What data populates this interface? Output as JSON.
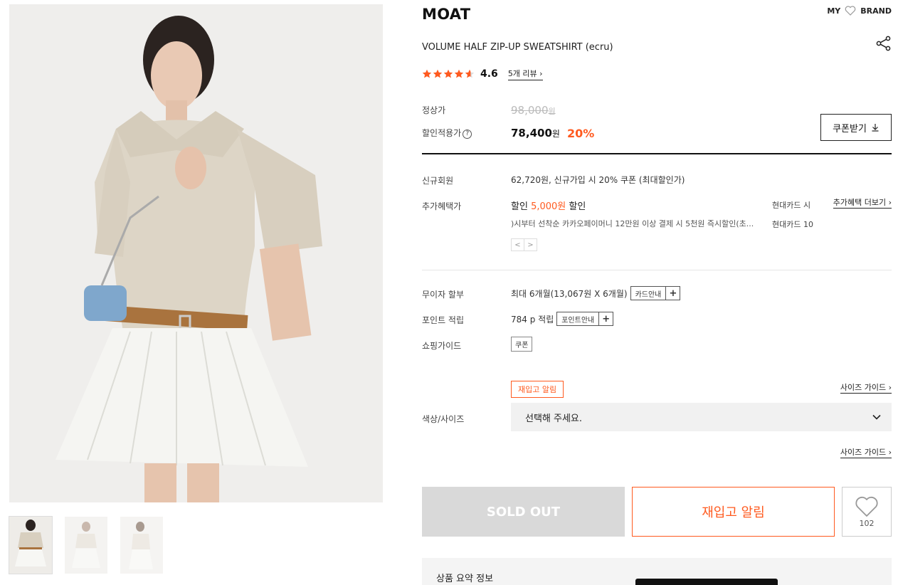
{
  "gallery": {
    "main_image_alt": "model wearing ecru half zip-up sweatshirt and white pleated skirt",
    "thumbnails": [
      "thumb-1",
      "thumb-2",
      "thumb-3"
    ]
  },
  "header": {
    "brand": "MOAT",
    "my_label": "MY",
    "brand_label": "BRAND"
  },
  "product": {
    "title": "VOLUME HALF ZIP-UP SWEATSHIRT (ecru)",
    "rating": "4.6",
    "rating_value": 4.6,
    "review_link": "5개 리뷰"
  },
  "price": {
    "regular_label": "정상가",
    "regular_value": "98,000",
    "regular_unit": "원",
    "sale_label": "할인적용가",
    "sale_value": "78,400",
    "sale_unit": "원",
    "discount": "20%",
    "coupon_button": "쿠폰받기",
    "help_symbol": "?"
  },
  "benefits": {
    "new_member_label": "신규회원",
    "new_member_value": "62,720원, 신규가입 시 20% 쿠폰 (최대할인가)",
    "extra_label": "추가혜택가",
    "extra_main_prefix": "할인 ",
    "extra_main_amount": "5,000원",
    "extra_main_suffix": " 할인",
    "extra_sub": ")시부터 선착순 카카오페이머니 12만원 이상 결제 시 5천원 즉시할인(초...",
    "card_1": "현대카드 시",
    "card_2": "현대카드 10",
    "more_link": "추가혜택 더보기",
    "pager_prev": "<",
    "pager_next": ">"
  },
  "installment": {
    "label": "무이자 할부",
    "value": "최대 6개월(13,067원 X 6개월)",
    "button": "카드안내"
  },
  "points": {
    "label": "포인트 적립",
    "value": "784 p 적립",
    "button": "포인트안내"
  },
  "shopping_guide": {
    "label": "쇼핑가이드",
    "tag": "쿠폰"
  },
  "options": {
    "restock_tag": "재입고 알림",
    "size_guide": "사이즈 가이드",
    "label": "색상/사이즈",
    "select_placeholder": "선택해 주세요.",
    "size_guide_2": "사이즈 가이드"
  },
  "actions": {
    "sold_out": "SOLD OUT",
    "restock": "재입고 알림",
    "wish_count": "102"
  },
  "summary": {
    "title": "상품 요약 정보"
  },
  "colors": {
    "accent": "#ff5a1f",
    "star": "#ff5a1f",
    "sold_out_bg": "#d9d9d9"
  }
}
